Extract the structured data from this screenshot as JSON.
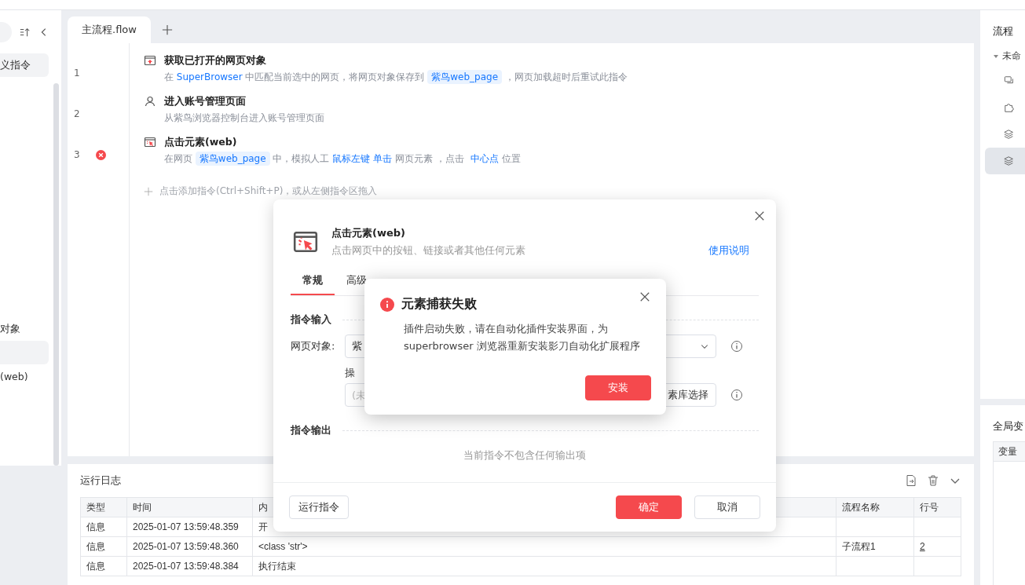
{
  "sidebar": {
    "items": [
      {
        "label": "义指令",
        "selected": true
      },
      {
        "label": "对象",
        "selected": false
      },
      {
        "selected": true
      },
      {
        "label": "(web)",
        "selected": false
      }
    ]
  },
  "editor": {
    "tabs": [
      {
        "label": "主流程.flow",
        "selected": true
      }
    ],
    "steps": [
      {
        "line": "1",
        "kind": "browser",
        "error": false,
        "title": "获取已打开的网页对象",
        "desc": [
          {
            "kind": "plain",
            "text": "在 "
          },
          {
            "kind": "link",
            "text": "SuperBrowser"
          },
          {
            "kind": "plain",
            "text": " 中匹配当前选中的网页，将网页对象保存到 "
          },
          {
            "kind": "var",
            "text": "紫鸟web_page"
          },
          {
            "kind": "plain",
            "text": " ，网页加载超时后重试此指令"
          }
        ]
      },
      {
        "line": "2",
        "kind": "user",
        "error": false,
        "title": "进入账号管理页面",
        "desc": [
          {
            "kind": "plain",
            "text": "从紫鸟浏览器控制台进入账号管理页面"
          }
        ]
      },
      {
        "line": "3",
        "kind": "click",
        "error": true,
        "title": "点击元素(web)",
        "desc": [
          {
            "kind": "plain",
            "text": "在网页 "
          },
          {
            "kind": "var",
            "text": "紫鸟web_page"
          },
          {
            "kind": "plain",
            "text": " 中，模拟人工 "
          },
          {
            "kind": "link",
            "text": "鼠标左键"
          },
          {
            "kind": "link",
            "text": "单击"
          },
          {
            "kind": "plain",
            "text": " 网页元素 ，点击 "
          },
          {
            "kind": "link",
            "text": "中心点"
          },
          {
            "kind": "plain",
            "text": " 位置"
          }
        ]
      }
    ],
    "add_hint": "点击添加指令(Ctrl+Shift+P)，或从左侧指令区拖入"
  },
  "log": {
    "title": "运行日志",
    "columns": [
      "类型",
      "时间",
      "内",
      "流程名称",
      "行号"
    ],
    "rows": [
      {
        "type": "信息",
        "time": "2025-01-07 13:59:48.359",
        "content": "开"
      },
      {
        "type": "信息",
        "time": "2025-01-07 13:59:48.360",
        "content": "<class 'str'>",
        "flow": "子流程1",
        "line": "2"
      },
      {
        "type": "信息",
        "time": "2025-01-07 13:59:48.384",
        "content": "执行结束"
      }
    ]
  },
  "right_panel": {
    "title": "流程",
    "tree": {
      "label": "未命",
      "expanded": true,
      "children": [
        {
          "kind": "comment",
          "selected": false
        },
        {
          "kind": "puzzle",
          "selected": false
        },
        {
          "kind": "layers",
          "selected": false
        },
        {
          "kind": "layers",
          "selected": true
        }
      ]
    },
    "variables": {
      "title": "全局变",
      "columns": [
        "变量"
      ]
    }
  },
  "dialog": {
    "title": "点击元素(web)",
    "subtitle": "点击网页中的按钮、链接或者其他任何元素",
    "help_link": "使用说明",
    "tabs": [
      {
        "label": "常规",
        "selected": true
      },
      {
        "label": "高级",
        "selected": false
      }
    ],
    "input_section": "指令输入",
    "page_field": {
      "label": "网页对象:",
      "value": "紫"
    },
    "operation": {
      "label": "操",
      "placeholder": "(未",
      "button": "素库选择"
    },
    "output_section": "指令输出",
    "output_empty": "当前指令不包含任何输出项",
    "run_button": "运行指令",
    "ok_button": "确定",
    "cancel_button": "取消"
  },
  "alert": {
    "title": "元素捕获失败",
    "message_lines": [
      "插件启动失败，请在自动化插件安装界面，为",
      "superbrowser 浏览器重新安装影刀自动化扩展程序"
    ],
    "button": "安装"
  }
}
